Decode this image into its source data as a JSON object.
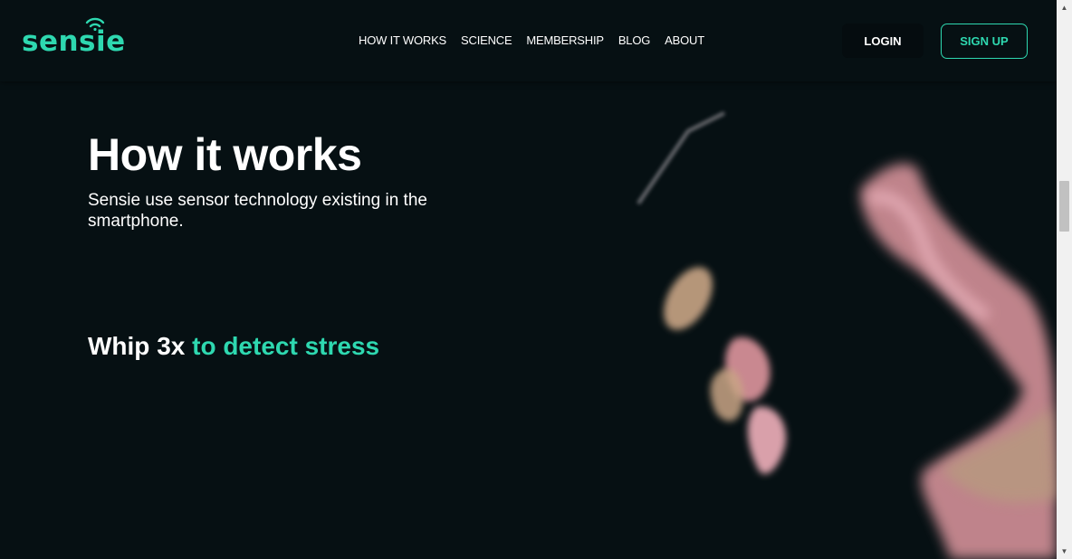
{
  "brand": {
    "name": "sensie",
    "accent": "#2ed8b0",
    "icon": "wifi-signal-icon"
  },
  "nav": {
    "items": [
      "HOW IT WORKS",
      "SCIENCE",
      "MEMBERSHIP",
      "BLOG",
      "ABOUT"
    ]
  },
  "header": {
    "login_label": "LOGIN",
    "signup_label": "SIGN UP"
  },
  "hero": {
    "title": "How it works",
    "subtitle": "Sensie use sensor technology existing in the smartphone.",
    "feature_prefix": "Whip 3x",
    "feature_highlight": "to detect stress"
  },
  "colors": {
    "background": "#061013",
    "accent": "#2ed8b0",
    "text": "#ffffff"
  }
}
